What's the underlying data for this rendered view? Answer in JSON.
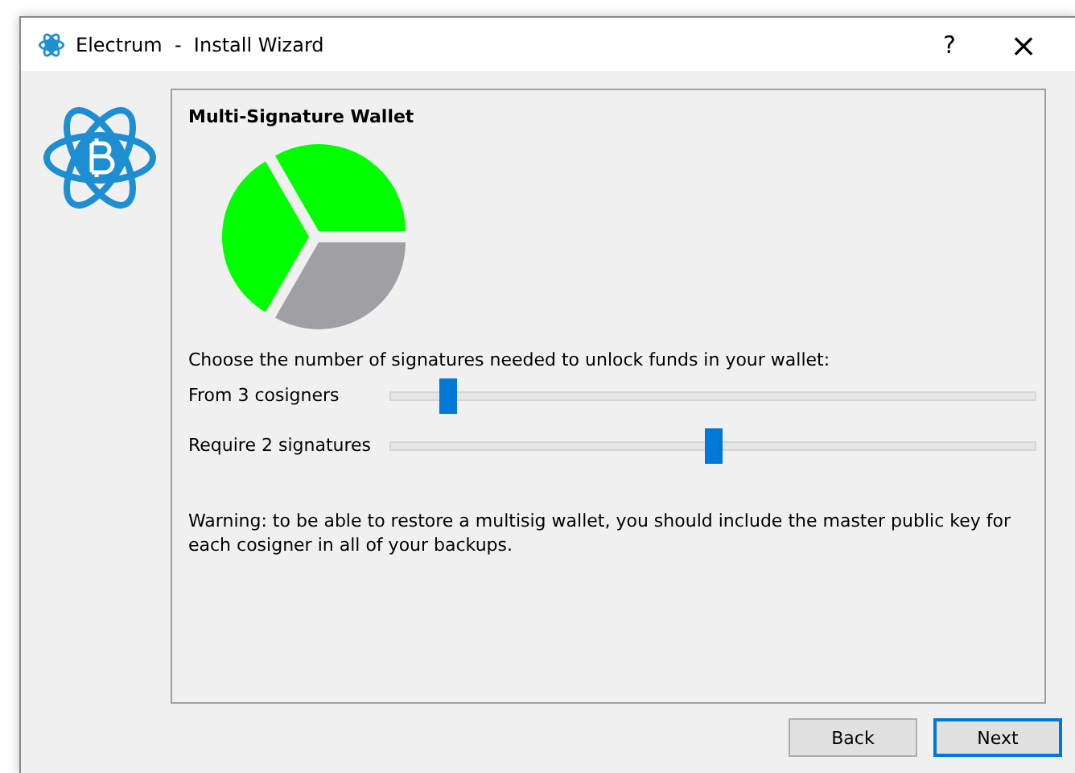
{
  "window": {
    "title": "Electrum  -  Install Wizard",
    "help": "?",
    "close": "×"
  },
  "page": {
    "heading": "Multi-Signature Wallet",
    "pie": {
      "slices": [
        {
          "color": "#00ff00"
        },
        {
          "color": "#a0a0a4"
        },
        {
          "color": "#00ff00"
        }
      ]
    },
    "prompt": "Choose the number of signatures needed to unlock funds in your wallet:",
    "sliders": [
      {
        "label": "From 3 cosigners",
        "level": 0.09
      },
      {
        "label": "Require 2 signatures",
        "level": 0.5
      }
    ],
    "warning": "Warning: to be able to restore a multisig wallet, you should include the master public key for each cosigner in all of your backups."
  },
  "buttons": [
    {
      "label": "Back",
      "selected": false
    },
    {
      "label": "Next",
      "selected": true
    }
  ]
}
